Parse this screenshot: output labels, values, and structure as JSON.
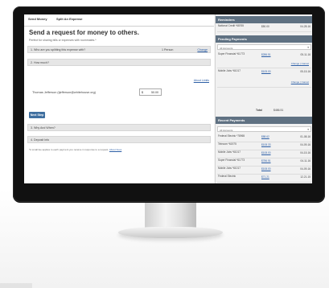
{
  "left": {
    "tabs": [
      "Send Money",
      "Split An Expense"
    ],
    "heading": "Send a request for money to others.",
    "subtext": "Perfect for sharing bills or expenses with roommates.*",
    "step1": {
      "label": "1. Who are you splitting this expense with?",
      "value": "1 Person",
      "link": "Change"
    },
    "step2": {
      "label": "2. How much?"
    },
    "about_link": "About Limits",
    "person": "Thomas Jefferson (tjefferson@whitehouse.org)",
    "amount": {
      "currency": "$",
      "value": "50.00"
    },
    "next_button": "Next Step",
    "step3": {
      "label": "3. Why And When?"
    },
    "step4": {
      "label": "4. Deposit Info"
    },
    "footnote": "*A small fee applies to each payment you receive in response to a request.",
    "footnote_link": "About Fees"
  },
  "right": {
    "reminders": {
      "title": "Reminders",
      "items": [
        {
          "name": "National Credit *68765",
          "amount": "$50.00",
          "date": "04-28-16"
        }
      ]
    },
    "pending": {
      "title": "Pending Payments",
      "filter": "All Accounts",
      "items": [
        {
          "name": "Super Financial *61773",
          "amount": "$286.51",
          "date": "05-11-16",
          "links": "Change | Cancel"
        },
        {
          "name": "Mobile Jobs *61017",
          "amount": "$105.00",
          "date": "05-15-16",
          "links": "Change | Cancel"
        }
      ],
      "total_label": "Total",
      "total_value": "$486.51"
    },
    "recent": {
      "title": "Recent Payments",
      "filter": "All Accounts",
      "items": [
        {
          "name": "Federal Electric *78965",
          "amount": "$88.62",
          "date": "01-08-16"
        },
        {
          "name": "Telecom *61975",
          "amount": "$108.33",
          "date": "04-09-16"
        },
        {
          "name": "Mobile Jobs *61017",
          "amount": "$108.00",
          "date": "04-15-16"
        },
        {
          "name": "Super Financial *61773",
          "amount": "$786.51",
          "date": "04-11-16"
        },
        {
          "name": "Mobile Jobs *61017",
          "amount": "$108.00",
          "date": "04-09-16"
        },
        {
          "name": "Federal Electric",
          "amount": "$71.21",
          "date": "12-21-15"
        }
      ]
    }
  }
}
